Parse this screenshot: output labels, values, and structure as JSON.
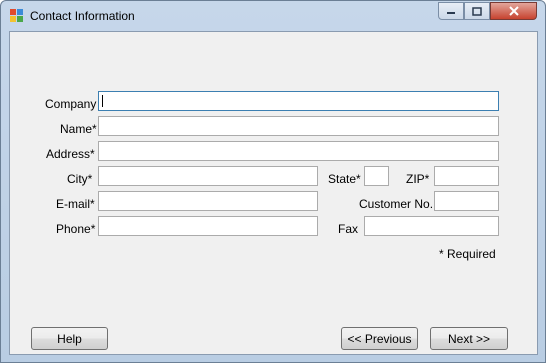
{
  "window": {
    "title": "Contact Information",
    "controls": {
      "minimize": "minimize",
      "maximize": "maximize",
      "close": "close"
    }
  },
  "form": {
    "company_label": "Company",
    "name_label": "Name*",
    "address_label": "Address*",
    "city_label": "City*",
    "state_label": "State*",
    "zip_label": "ZIP*",
    "email_label": "E-mail*",
    "customer_no_label": "Customer No.",
    "phone_label": "Phone*",
    "fax_label": "Fax",
    "required_note": "* Required"
  },
  "fields": {
    "company": "",
    "name": "",
    "address": "",
    "city": "",
    "state": "",
    "zip": "",
    "email": "",
    "customer_no": "",
    "phone": "",
    "fax": ""
  },
  "buttons": {
    "help": "Help",
    "previous": "<< Previous",
    "next": "Next >>"
  }
}
